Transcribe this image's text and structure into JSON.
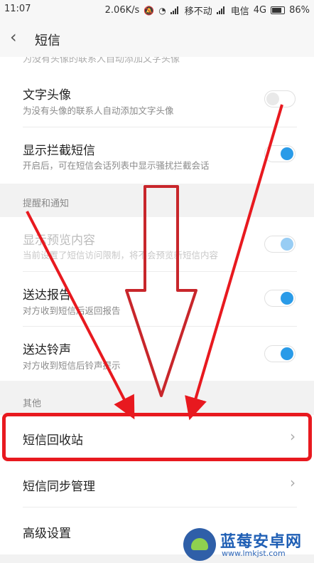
{
  "status_bar": {
    "time": "11:07",
    "speed": "2.06K/s",
    "carrier1": "移不动",
    "carrier2": "电信",
    "network": "4G",
    "battery": "86%"
  },
  "header": {
    "back_icon": "chevron-left-icon",
    "title": "短信"
  },
  "partial_row_text": "为没有头像的联系人自动添加文字头像",
  "settings": {
    "text_avatar": {
      "title": "文字头像",
      "subtitle": "为没有头像的联系人自动添加文字头像",
      "enabled": false
    },
    "show_blocked": {
      "title": "显示拦截短信",
      "subtitle": "开启后，可在短信会话列表中显示骚扰拦截会话",
      "enabled": true
    }
  },
  "notify_section": {
    "label": "提醒和通知",
    "preview": {
      "title": "显示预览内容",
      "subtitle": "当前设置了短信访问限制，将不会预览新短信内容",
      "enabled": true,
      "disabled": true
    },
    "delivery_report": {
      "title": "送达报告",
      "subtitle": "对方收到短信后返回报告",
      "enabled": true
    },
    "delivery_ringtone": {
      "title": "送达铃声",
      "subtitle": "对方收到短信后铃声提示",
      "enabled": true
    }
  },
  "other_section": {
    "label": "其他",
    "recycle_bin": "短信回收站",
    "sync_manage": "短信同步管理",
    "advanced": "高级设置"
  },
  "annotation": {
    "highlight_color": "#e8191f"
  },
  "watermark": {
    "brand": "蓝莓安卓网",
    "url": "www.lmkjst.com"
  },
  "colors": {
    "toggle_on": "#2a9be8",
    "background": "#f2f2f2"
  }
}
